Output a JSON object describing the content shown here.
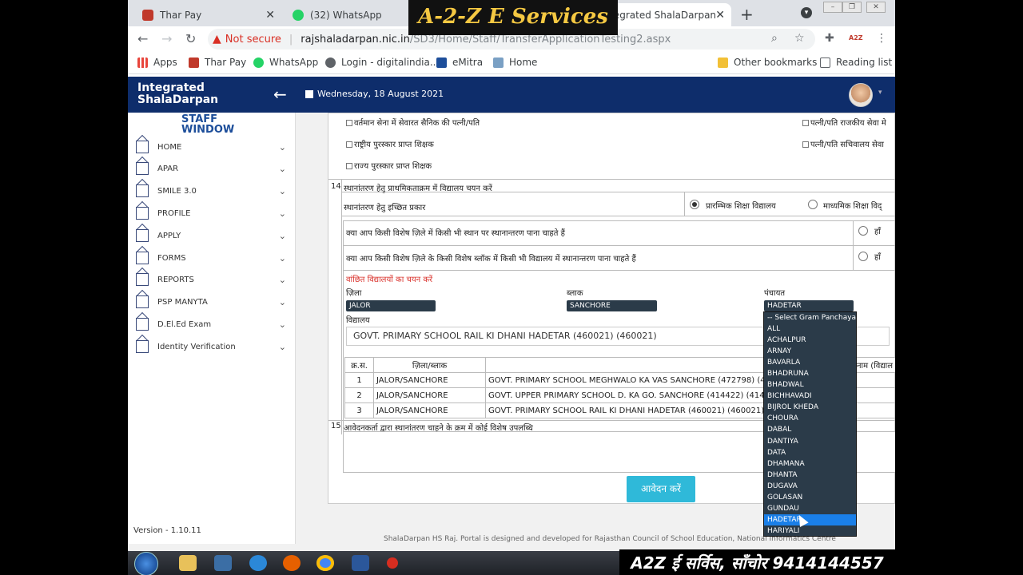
{
  "browser": {
    "tabs": [
      {
        "title": "Thar Pay",
        "favicon_color": "#c0392b"
      },
      {
        "title": "(32) WhatsApp",
        "favicon_color": "#25d366"
      },
      {
        "title": "Integrated ShalaDarpan",
        "favicon_color": "#1d4e9a"
      }
    ],
    "url_warning": "Not secure",
    "url_host": "rajshaladarpan.nic.in",
    "url_path": "/SD3/Home/Staff/TransferApplicationTesting2.aspx",
    "bookmarks": [
      "Apps",
      "Thar Pay",
      "WhatsApp",
      "Login - digitalindia...",
      "eMitra",
      "Home",
      "Other bookmarks",
      "Reading list"
    ]
  },
  "header": {
    "logo_line1": "Integrated",
    "logo_line2": "ShalaDarpan",
    "date": "Wednesday, 18 August 2021"
  },
  "sidebar": {
    "brand_line1": "STAFF",
    "brand_line2": "WINDOW",
    "items": [
      {
        "label": "HOME"
      },
      {
        "label": "APAR"
      },
      {
        "label": "SMILE 3.0"
      },
      {
        "label": "PROFILE"
      },
      {
        "label": "APPLY"
      },
      {
        "label": "FORMS"
      },
      {
        "label": "REPORTS"
      },
      {
        "label": "PSP MANYTA"
      },
      {
        "label": "D.El.Ed Exam"
      },
      {
        "label": "Identity Verification"
      }
    ],
    "version": "Version - 1.10.11"
  },
  "form": {
    "checks": {
      "army": "वर्तमान सेना में सेवारत सैनिक की पत्नी/पति",
      "national_award": "राष्ट्रीय पुरस्कार प्राप्त शिक्षक",
      "state_award": "राज्य पुरस्कार प्राप्त शिक्षक",
      "spouse_state": "पत्नी/पति राजकीय सेवा मे",
      "spouse_secretariat": "पत्नी/पति सचिवालय सेवा"
    },
    "section14_no": "14",
    "section14_title": "स्थानांतरण हेतु प्राथमिकताक्रम में विद्यालय चयन करें",
    "desired_type_label": "स्थानांतरण हेतु इच्छित प्रकार",
    "radio_primary": "प्रारम्भिक शिक्षा विद्यालय",
    "radio_secondary": "माध्यमिक शिक्षा विद्",
    "question1": "क्या आप किसी विशेष ज़िले में किसी भी स्थान पर स्थानान्तरण पाना चाहते हैं",
    "question2": "क्या आप किसी विशेष ज़िले के किसी विशेष ब्लॉक में किसी भी विद्यालय में स्थानान्तरण पाना चाहते हैं",
    "yes": "हाँ",
    "select_schools_label": "वांछित विद्यालयों का चयन करें",
    "district_label": "ज़िला",
    "block_label": "ब्लाक",
    "panchayat_label": "पंचायत",
    "district_value": "JALOR",
    "block_value": "SANCHORE",
    "panchayat_value": "HADETAR",
    "school_label": "विद्यालय",
    "school_value": "GOVT. PRIMARY SCHOOL RAIL KI DHANI HADETAR (460021) (460021)",
    "table_headers": [
      "क्र.स.",
      "ज़िला/ब्लाक",
      "चयनित विद्यालय / कार्यालय का नाम (विद्याल"
    ],
    "table_rows": [
      [
        "1",
        "JALOR/SANCHORE",
        "GOVT. PRIMARY SCHOOL MEGHWALO KA VAS SANCHORE (472798) (472"
      ],
      [
        "2",
        "JALOR/SANCHORE",
        "GOVT. UPPER PRIMARY SCHOOL D. KA GO. SANCHORE (414422) (41442"
      ],
      [
        "3",
        "JALOR/SANCHORE",
        "GOVT. PRIMARY SCHOOL RAIL KI DHANI HADETAR (460021) (460021)"
      ]
    ],
    "section15_no": "15",
    "section15_title": "आवेदनकर्ता द्वारा स्थानांतरण चाहने के क्रम में कोई विशेष उपलब्धि",
    "submit_label": "आवेदन करें"
  },
  "dropdown": {
    "options": [
      "-- Select Gram Panchayat --",
      "ALL",
      "ACHALPUR",
      "ARNAY",
      "BAVARLA",
      "BHADRUNA",
      "BHADWAL",
      "BICHHAVADI",
      "BIJROL KHEDA",
      "CHOURA",
      "DABAL",
      "DANTIYA",
      "DATA",
      "DHAMANA",
      "DHANTA",
      "DUGAVA",
      "GOLASAN",
      "GUNDAU",
      "HADETAR",
      "HARIYALI"
    ],
    "selected_index": 18
  },
  "footer_text": "ShalaDarpan HS Raj. Portal is designed and developed for Rajasthan Council of School Education, National Informatics Centre",
  "overlay": {
    "brand": "A-2-Z E Services",
    "contact": "A2Z ई सर्विस, साँचोर 9414144557"
  },
  "colors": {
    "header_bg": "#0e2d6b",
    "submit_bg": "#2fb9d9",
    "select_bg": "#2b3b49",
    "highlight": "#1a7fe8"
  }
}
